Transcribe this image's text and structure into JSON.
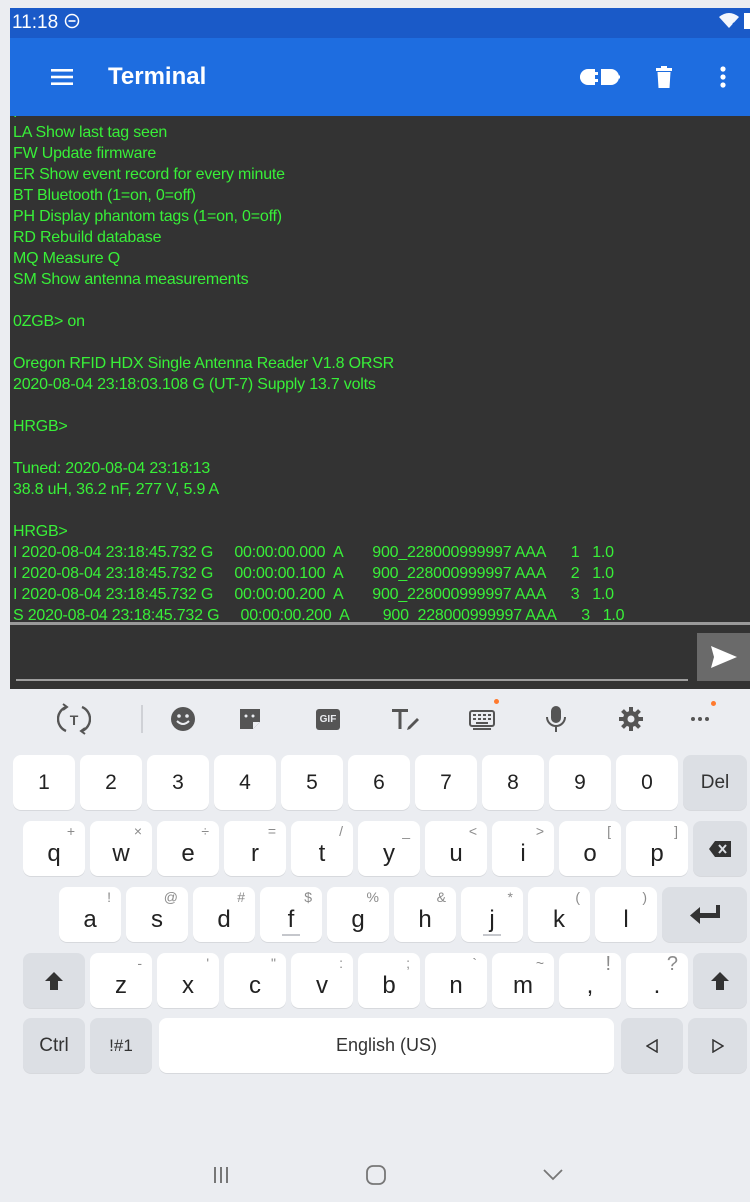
{
  "status_bar": {
    "time": "11:18"
  },
  "app_bar": {
    "title": "Terminal"
  },
  "terminal": {
    "lines": [
      "LA Show last tag seen",
      "FW Update firmware",
      "ER Show event record for every minute",
      "BT Bluetooth (1=on, 0=off)",
      "PH Display phantom tags (1=on, 0=off)",
      "RD Rebuild database",
      "MQ Measure Q",
      "SM Show antenna measurements",
      "",
      "0ZGB> on",
      "",
      "Oregon RFID HDX Single Antenna Reader V1.8 ORSR",
      "2020-08-04 23:18:03.108 G (UT-7) Supply 13.7 volts",
      "",
      "HRGB>",
      "",
      "Tuned: 2020-08-04 23:18:13",
      "38.8 uH, 36.2 nF, 277 V, 5.9 A",
      "",
      "HRGB>",
      "I 2020-08-04 23:18:45.732 G     00:00:00.000  A       900_228000999997 AAA      1   1.0",
      "I 2020-08-04 23:18:45.732 G     00:00:00.100  A       900_228000999997 AAA      2   1.0",
      "I 2020-08-04 23:18:45.732 G     00:00:00.200  A       900_228000999997 AAA      3   1.0",
      "S 2020-08-04 23:18:45.732 G     00:00:00.200  A        900_228000999997 AAA      3   1.0"
    ]
  },
  "input": {
    "value": ""
  },
  "keyboard": {
    "number_row": [
      "1",
      "2",
      "3",
      "4",
      "5",
      "6",
      "7",
      "8",
      "9",
      "0"
    ],
    "del_label": "Del",
    "row_q": [
      {
        "key": "q",
        "hint": "+"
      },
      {
        "key": "w",
        "hint": "×"
      },
      {
        "key": "e",
        "hint": "÷"
      },
      {
        "key": "r",
        "hint": "="
      },
      {
        "key": "t",
        "hint": "/"
      },
      {
        "key": "y",
        "hint": "_"
      },
      {
        "key": "u",
        "hint": "<"
      },
      {
        "key": "i",
        "hint": ">"
      },
      {
        "key": "o",
        "hint": "["
      },
      {
        "key": "p",
        "hint": "]"
      }
    ],
    "row_a": [
      {
        "key": "a",
        "hint": "!"
      },
      {
        "key": "s",
        "hint": "@"
      },
      {
        "key": "d",
        "hint": "#"
      },
      {
        "key": "f",
        "hint": "$"
      },
      {
        "key": "g",
        "hint": "%"
      },
      {
        "key": "h",
        "hint": "&"
      },
      {
        "key": "j",
        "hint": "*"
      },
      {
        "key": "k",
        "hint": "("
      },
      {
        "key": "l",
        "hint": ")"
      }
    ],
    "row_z": [
      {
        "key": "z",
        "hint": "-"
      },
      {
        "key": "x",
        "hint": "'"
      },
      {
        "key": "c",
        "hint": "\""
      },
      {
        "key": "v",
        "hint": ":"
      },
      {
        "key": "b",
        "hint": ";"
      },
      {
        "key": "n",
        "hint": "`"
      },
      {
        "key": "m",
        "hint": "~"
      },
      {
        "key": ",",
        "hint": "!"
      },
      {
        "key": ".",
        "hint": "?"
      }
    ],
    "ctrl_label": "Ctrl",
    "symbols_label": "!#1",
    "space_label": "English (US)",
    "toolbar_gif": "GIF"
  },
  "colors": {
    "status_bar": "#1a5ac8",
    "app_bar": "#1e6de0",
    "terminal_bg": "#333333",
    "terminal_text": "#38f038",
    "badge": "#ff7a2e"
  },
  "icons": [
    "menu-icon",
    "connection-icon",
    "trash-icon",
    "more-vert-icon",
    "send-icon",
    "translate-icon",
    "emoji-icon",
    "sticker-icon",
    "gif-icon",
    "text-style-icon",
    "keyboard-layout-icon",
    "mic-icon",
    "settings-icon",
    "more-horiz-icon",
    "backspace-icon",
    "enter-icon",
    "shift-icon",
    "arrow-left-icon",
    "arrow-right-icon",
    "nav-recents-icon",
    "nav-home-icon",
    "nav-back-icon"
  ]
}
